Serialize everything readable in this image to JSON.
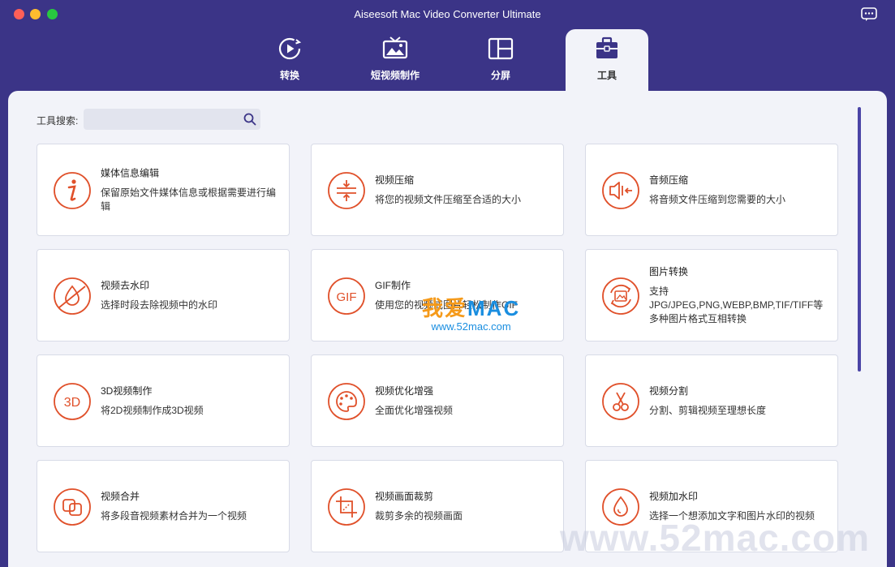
{
  "window": {
    "title": "Aiseesoft Mac Video Converter Ultimate"
  },
  "tabs": [
    {
      "label": "转换",
      "icon": "convert-icon",
      "active": false
    },
    {
      "label": "短视频制作",
      "icon": "mv-icon",
      "active": false
    },
    {
      "label": "分屏",
      "icon": "split-screen-icon",
      "active": false
    },
    {
      "label": "工具",
      "icon": "toolbox-icon",
      "active": true
    }
  ],
  "search": {
    "label": "工具搜索:",
    "value": "",
    "placeholder": ""
  },
  "tools": [
    {
      "name": "媒体信息编辑",
      "desc": "保留原始文件媒体信息或根据需要进行编辑",
      "icon": "info-icon"
    },
    {
      "name": "视频压缩",
      "desc": "将您的视频文件压缩至合适的大小",
      "icon": "video-compress-icon"
    },
    {
      "name": "音频压缩",
      "desc": "将音频文件压缩到您需要的大小",
      "icon": "audio-compress-icon"
    },
    {
      "name": "视频去水印",
      "desc": "选择时段去除视频中的水印",
      "icon": "watermark-remove-icon"
    },
    {
      "name": "GIF制作",
      "desc": "使用您的视频或图片轻松制作GIF",
      "icon": "gif-icon"
    },
    {
      "name": "图片转换",
      "desc": "支持JPG/JPEG,PNG,WEBP,BMP,TIF/TIFF等多种图片格式互相转换",
      "icon": "image-convert-icon"
    },
    {
      "name": "3D视频制作",
      "desc": "将2D视频制作成3D视频",
      "icon": "3d-icon"
    },
    {
      "name": "视频优化增强",
      "desc": "全面优化增强视频",
      "icon": "palette-icon"
    },
    {
      "name": "视频分割",
      "desc": "分割、剪辑视频至理想长度",
      "icon": "scissors-icon"
    },
    {
      "name": "视频合并",
      "desc": "将多段音视频素材合并为一个视频",
      "icon": "merge-icon"
    },
    {
      "name": "视频画面裁剪",
      "desc": "裁剪多余的视频画面",
      "icon": "crop-icon"
    },
    {
      "name": "视频加水印",
      "desc": "选择一个想添加文字和图片水印的视频",
      "icon": "watermark-add-icon"
    }
  ],
  "watermark": {
    "line1a": "我爱",
    "line1b": "MAC",
    "line2": "www.52mac.com",
    "corner": "www.52mac.com"
  },
  "colors": {
    "brand": "#3b3487",
    "accent": "#e0502a",
    "background": "#f2f3f9"
  }
}
